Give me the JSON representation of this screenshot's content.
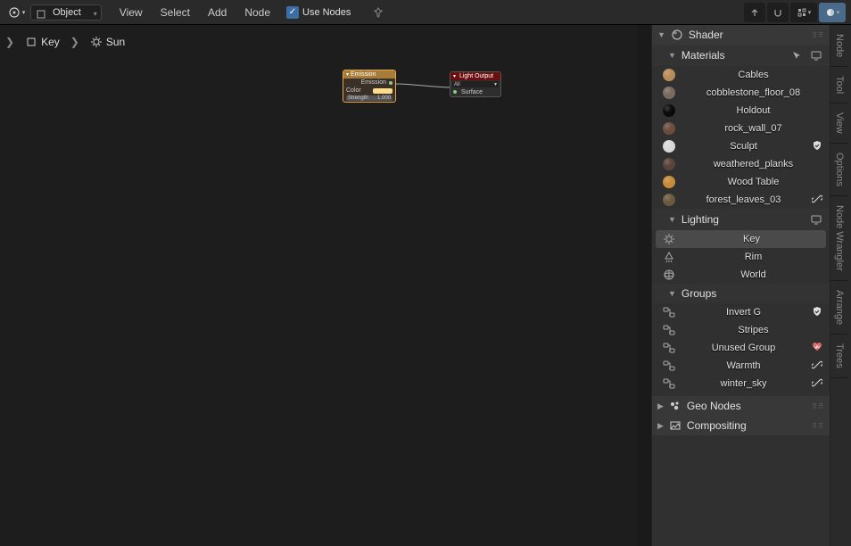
{
  "header": {
    "mode_label": "Object",
    "menus": [
      "View",
      "Select",
      "Add",
      "Node"
    ],
    "use_nodes_label": "Use Nodes",
    "use_nodes_checked": true
  },
  "breadcrumb": {
    "items": [
      {
        "icon": "object",
        "label": "Key"
      },
      {
        "icon": "sun",
        "label": "Sun"
      }
    ]
  },
  "nodes": {
    "emission": {
      "title": "Emission",
      "output_socket": "Emission",
      "color_label": "Color",
      "strength_label": "Strength",
      "strength_value": "1.000"
    },
    "output": {
      "title": "Light Output",
      "target": "All",
      "socket": "Surface"
    }
  },
  "sidebar": {
    "shader_panel": "Shader",
    "materials_header": "Materials",
    "lighting_header": "Lighting",
    "groups_header": "Groups",
    "geo_header": "Geo Nodes",
    "compositing_header": "Compositing",
    "materials": [
      {
        "name": "Cables",
        "color": "#b88c5a"
      },
      {
        "name": "cobblestone_floor_08",
        "color": "#776a5e"
      },
      {
        "name": "Holdout",
        "color": "#0a0a0a"
      },
      {
        "name": "rock_wall_07",
        "color": "#6b4e3f"
      },
      {
        "name": "Sculpt",
        "color": "#d8d8d8",
        "status": "shield"
      },
      {
        "name": "weathered_planks",
        "color": "#5a443a"
      },
      {
        "name": "Wood Table",
        "color": "#c78b3a"
      },
      {
        "name": "forest_leaves_03",
        "color": "#6a5a3e",
        "status": "link"
      }
    ],
    "lighting": [
      {
        "name": "Key",
        "icon": "sun",
        "active": true
      },
      {
        "name": "Rim",
        "icon": "spot"
      },
      {
        "name": "World",
        "icon": "world"
      }
    ],
    "groups": [
      {
        "name": "Invert G",
        "status": "shield"
      },
      {
        "name": "Stripes"
      },
      {
        "name": "Unused Group",
        "status": "heart"
      },
      {
        "name": "Warmth",
        "status": "link"
      },
      {
        "name": "winter_sky",
        "status": "link"
      }
    ]
  },
  "vtabs": [
    "Node",
    "Tool",
    "View",
    "Options",
    "Node Wrangler",
    "Arrange",
    "Trees"
  ]
}
